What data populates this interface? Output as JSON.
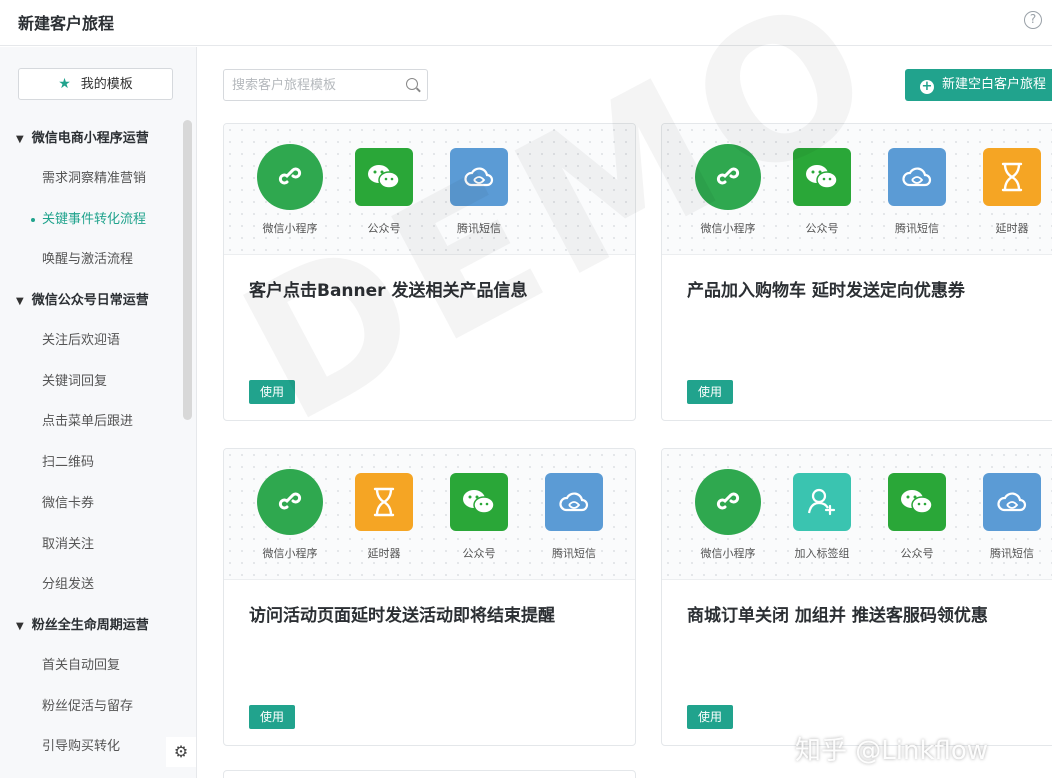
{
  "header": {
    "title": "新建客户旅程",
    "help_glyph": "?"
  },
  "sidebar": {
    "my_templates": {
      "label": "我的模板",
      "icon": "star-icon"
    },
    "groups": [
      {
        "title": "微信电商小程序运营",
        "items": [
          {
            "label": "需求洞察精准营销",
            "active": false
          },
          {
            "label": "关键事件转化流程",
            "active": true
          },
          {
            "label": "唤醒与激活流程",
            "active": false
          }
        ]
      },
      {
        "title": "微信公众号日常运营",
        "items": [
          {
            "label": "关注后欢迎语",
            "active": false
          },
          {
            "label": "关键词回复",
            "active": false
          },
          {
            "label": "点击菜单后跟进",
            "active": false
          },
          {
            "label": "扫二维码",
            "active": false
          },
          {
            "label": "微信卡券",
            "active": false
          },
          {
            "label": "取消关注",
            "active": false
          },
          {
            "label": "分组发送",
            "active": false
          }
        ]
      },
      {
        "title": "粉丝全生命周期运营",
        "items": [
          {
            "label": "首关自动回复",
            "active": false
          },
          {
            "label": "粉丝促活与留存",
            "active": false
          },
          {
            "label": "引导购买转化",
            "active": false
          }
        ]
      }
    ],
    "settings_icon": "gear-icon"
  },
  "toolbar": {
    "search_placeholder": "搜索客户旅程模板",
    "new_button_label": "新建空白客户旅程"
  },
  "cards": [
    {
      "title": "客户点击Banner 发送相关产品信息",
      "use_label": "使用",
      "nodes": [
        {
          "type": "mini",
          "label": "微信小程序"
        },
        {
          "type": "wechat",
          "label": "公众号"
        },
        {
          "type": "sms",
          "label": "腾讯短信"
        }
      ]
    },
    {
      "title": "产品加入购物车 延时发送定向优惠券",
      "use_label": "使用",
      "nodes": [
        {
          "type": "mini",
          "label": "微信小程序"
        },
        {
          "type": "wechat",
          "label": "公众号"
        },
        {
          "type": "sms",
          "label": "腾讯短信"
        },
        {
          "type": "delay",
          "label": "延时器"
        }
      ]
    },
    {
      "title": "访问活动页面延时发送活动即将结束提醒",
      "use_label": "使用",
      "nodes": [
        {
          "type": "mini",
          "label": "微信小程序"
        },
        {
          "type": "delay",
          "label": "延时器"
        },
        {
          "type": "wechat",
          "label": "公众号"
        },
        {
          "type": "sms",
          "label": "腾讯短信"
        }
      ]
    },
    {
      "title": "商城订单关闭 加组并 推送客服码领优惠",
      "use_label": "使用",
      "nodes": [
        {
          "type": "mini",
          "label": "微信小程序"
        },
        {
          "type": "tag",
          "label": "加入标签组"
        },
        {
          "type": "wechat",
          "label": "公众号"
        },
        {
          "type": "sms",
          "label": "腾讯短信"
        }
      ]
    }
  ],
  "watermark": "DEMO",
  "credit": "知乎 @Linkflow",
  "colors": {
    "accent": "#21a38d",
    "mini": "#2fa84f",
    "wechat": "#2aa738",
    "sms": "#5b9bd5",
    "delay": "#f5a524",
    "tag": "#3ac4b0"
  }
}
